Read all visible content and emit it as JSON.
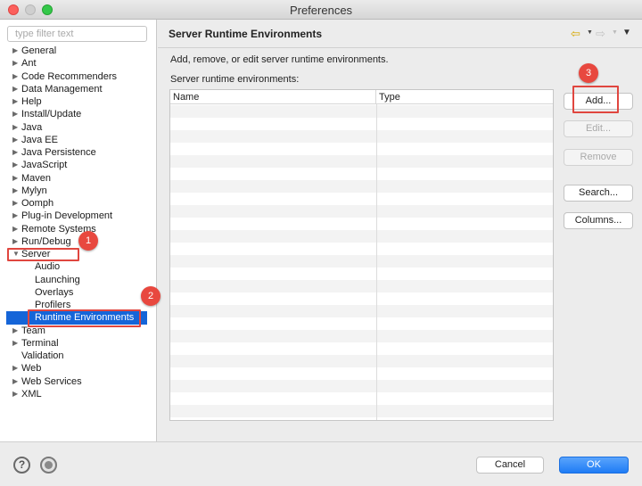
{
  "window": {
    "title": "Preferences"
  },
  "filter": {
    "placeholder": "type filter text"
  },
  "tree": {
    "items": [
      {
        "label": "General",
        "twisty": "closed"
      },
      {
        "label": "Ant",
        "twisty": "closed"
      },
      {
        "label": "Code Recommenders",
        "twisty": "closed"
      },
      {
        "label": "Data Management",
        "twisty": "closed"
      },
      {
        "label": "Help",
        "twisty": "closed"
      },
      {
        "label": "Install/Update",
        "twisty": "closed"
      },
      {
        "label": "Java",
        "twisty": "closed"
      },
      {
        "label": "Java EE",
        "twisty": "closed"
      },
      {
        "label": "Java Persistence",
        "twisty": "closed"
      },
      {
        "label": "JavaScript",
        "twisty": "closed"
      },
      {
        "label": "Maven",
        "twisty": "closed"
      },
      {
        "label": "Mylyn",
        "twisty": "closed"
      },
      {
        "label": "Oomph",
        "twisty": "closed"
      },
      {
        "label": "Plug-in Development",
        "twisty": "closed"
      },
      {
        "label": "Remote Systems",
        "twisty": "closed"
      },
      {
        "label": "Run/Debug",
        "twisty": "closed"
      },
      {
        "label": "Server",
        "twisty": "open"
      },
      {
        "label": "Audio",
        "twisty": "none"
      },
      {
        "label": "Launching",
        "twisty": "none"
      },
      {
        "label": "Overlays",
        "twisty": "none"
      },
      {
        "label": "Profilers",
        "twisty": "none"
      },
      {
        "label": "Runtime Environments",
        "twisty": "none",
        "selected": true
      },
      {
        "label": "Team",
        "twisty": "closed"
      },
      {
        "label": "Terminal",
        "twisty": "closed"
      },
      {
        "label": "Validation",
        "twisty": "none"
      },
      {
        "label": "Web",
        "twisty": "closed"
      },
      {
        "label": "Web Services",
        "twisty": "closed"
      },
      {
        "label": "XML",
        "twisty": "closed"
      }
    ]
  },
  "page": {
    "title": "Server Runtime Environments",
    "description": "Add, remove, or edit server runtime environments.",
    "table_label": "Server runtime environments:",
    "columns": [
      "Name",
      "Type"
    ]
  },
  "buttons": {
    "add": "Add...",
    "edit": "Edit...",
    "remove": "Remove",
    "search": "Search...",
    "columns": "Columns..."
  },
  "footer": {
    "cancel": "Cancel",
    "ok": "OK",
    "help": "?"
  },
  "callouts": [
    "1",
    "2",
    "3"
  ],
  "colors": {
    "accent": "#1f7cf5",
    "selection": "#1565d8",
    "callout": "#e8483f"
  },
  "icons": {
    "back": "back-arrow-icon",
    "forward": "forward-arrow-icon",
    "menu": "view-menu-icon"
  }
}
